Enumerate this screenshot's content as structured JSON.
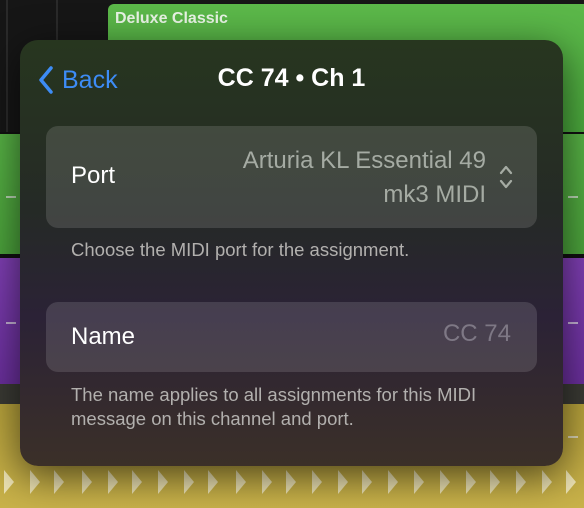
{
  "background": {
    "region_title": "Deluxe Classic",
    "colors": {
      "green": "#4fac40",
      "purple": "#7239a6",
      "yellow": "#c0aa44"
    }
  },
  "popover": {
    "back_label": "Back",
    "back_icon": "chevron-left-icon",
    "title": "CC 74 • Ch 1",
    "port": {
      "label": "Port",
      "value_line1": "Arturia KL Essential 49",
      "value_line2": "mk3 MIDI",
      "icon": "chevron-up-down-icon",
      "footnote": "Choose the MIDI port for the assignment."
    },
    "name": {
      "label": "Name",
      "placeholder": "CC 74",
      "footnote": "The name applies to all assignments for this MIDI message on this channel and port."
    },
    "accent_color": "#3d8cf5"
  }
}
